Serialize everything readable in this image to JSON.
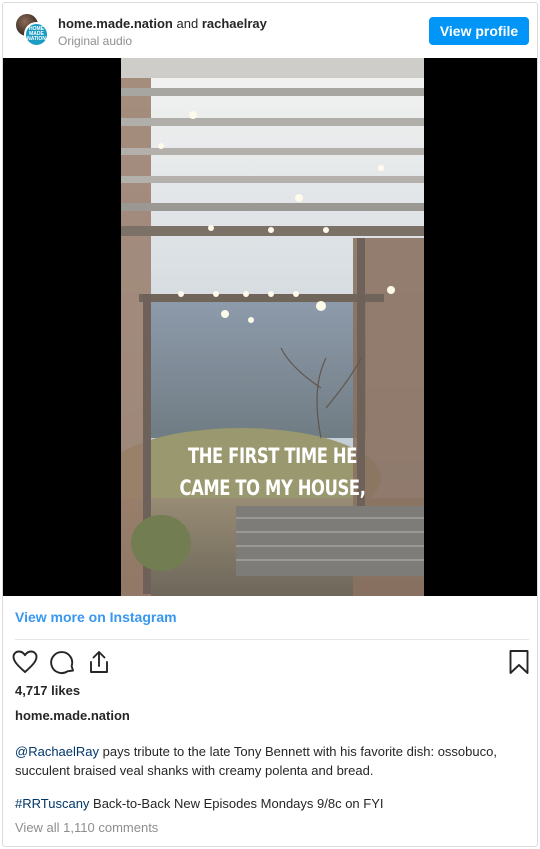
{
  "header": {
    "account_1": "home.made.nation",
    "conjunction": "and",
    "account_2": "rachaelray",
    "audio": "Original audio",
    "avatar_badge": "HOME MADE NATION",
    "view_profile": "View profile"
  },
  "video": {
    "overlay_line_1": "THE FIRST TIME HE",
    "overlay_line_2": "CAME TO MY HOUSE,"
  },
  "view_more": "View more on Instagram",
  "actions": {
    "like_icon": "heart-icon",
    "comment_icon": "comment-icon",
    "share_icon": "share-icon",
    "save_icon": "bookmark-icon"
  },
  "post": {
    "likes": "4,717 likes",
    "owner": "home.made.nation",
    "caption_mention": "@RachaelRay",
    "caption_text": " pays tribute to the late Tony Bennett with his favorite dish: ossobuco, succulent braised veal shanks with creamy polenta and bread.",
    "hashtag": "#RRTuscany",
    "hashtag_text": " Back-to-Back New Episodes Mondays 9/8c on FYI",
    "comments": "View all 1,110 comments"
  },
  "colors": {
    "accent": "#0095f6",
    "link": "#3897f0",
    "mention": "#00376b",
    "muted": "#8e8e8e"
  }
}
